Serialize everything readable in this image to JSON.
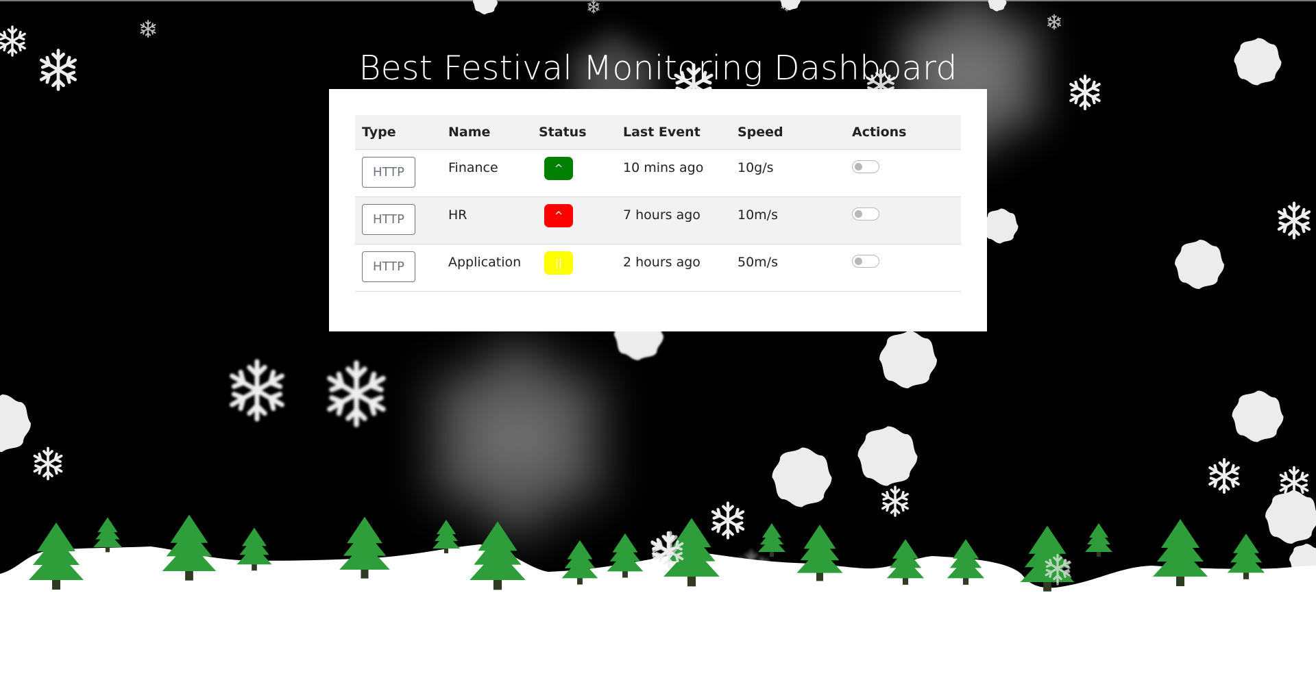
{
  "page": {
    "title": "Best Festival Monitoring Dashboard"
  },
  "table": {
    "headers": {
      "type": "Type",
      "name": "Name",
      "status": "Status",
      "last_event": "Last Event",
      "speed": "Speed",
      "actions": "Actions"
    },
    "rows": [
      {
        "type": "HTTP",
        "name": "Finance",
        "status_symbol": "^",
        "status_color": "#008000",
        "status_text_color": "#ffffff",
        "last_event": "10 mins ago",
        "speed": "10g/s",
        "enabled": false
      },
      {
        "type": "HTTP",
        "name": "HR",
        "status_symbol": "^",
        "status_color": "#ff0000",
        "status_text_color": "#ffffff",
        "last_event": "7 hours ago",
        "speed": "10m/s",
        "enabled": false
      },
      {
        "type": "HTTP",
        "name": "Application",
        "status_symbol": "||",
        "status_color": "#ffff00",
        "status_text_color": "#ffffff",
        "last_event": "2 hours ago",
        "speed": "50m/s",
        "enabled": false
      }
    ]
  },
  "theme": {
    "background": "#000000",
    "snow_ground": "#ffffff",
    "tree_color": "#2e9e3a",
    "trunk_color": "#2f3b23",
    "snowflake_color": "#ececec"
  }
}
